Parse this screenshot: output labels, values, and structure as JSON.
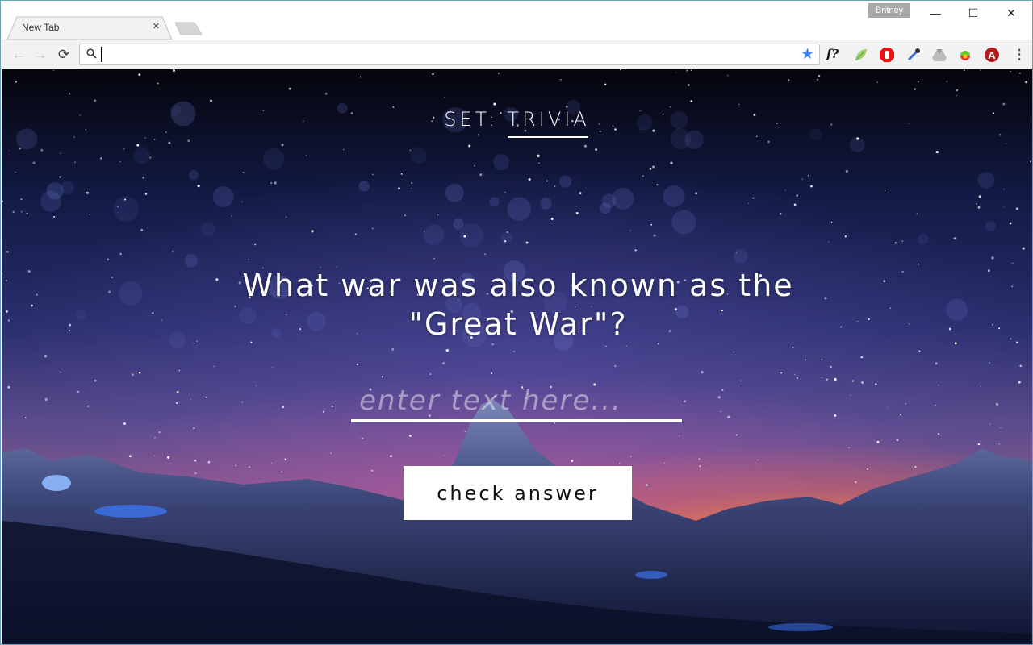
{
  "browser": {
    "tabs": [
      {
        "title": "New Tab",
        "close_icon": "×"
      }
    ],
    "profile_name": "Britney",
    "window_controls": {
      "minimize": "—",
      "maximize": "☐",
      "close": "✕"
    },
    "nav": {
      "back": "←",
      "forward": "→",
      "reload": "⟳"
    },
    "omnibox": {
      "value": "",
      "placeholder": ""
    },
    "bookmark_star": "★",
    "extensions": [
      {
        "name": "font-identifier-extension",
        "label": "f?"
      },
      {
        "name": "leaf-extension"
      },
      {
        "name": "adblock-extension"
      },
      {
        "name": "eyedropper-extension"
      },
      {
        "name": "google-drive-extension"
      },
      {
        "name": "color-wheel-extension"
      },
      {
        "name": "red-a-plus-extension",
        "label": "A"
      }
    ],
    "menu_icon": "⋮"
  },
  "page": {
    "set_label": "SET: TRIVIA",
    "question": "What war was also known as the \"Great War\"?",
    "answer_input": {
      "value": "",
      "placeholder": "enter text here..."
    },
    "check_button": "check answer"
  },
  "colors": {
    "star_blue": "#3b82f6",
    "profile_bg": "#a9a9a9",
    "button_bg": "#ffffff"
  }
}
